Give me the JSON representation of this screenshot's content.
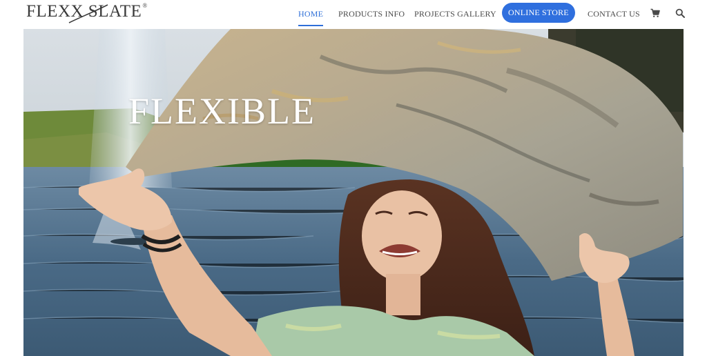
{
  "header": {
    "logo": {
      "text": "FLEXX SLATE",
      "registered": "®"
    },
    "nav": {
      "home": "HOME",
      "products": "PRODUCTS INFO",
      "gallery": "PROJECTS GALLERY",
      "store": "ONLINE STORE",
      "contact": "CONTACT US"
    },
    "icons": {
      "cart": "shopping-cart-icon",
      "search": "search-icon"
    },
    "active_tab": "HOME"
  },
  "hero": {
    "heading": "FLEXIBLE",
    "image": "woman-holding-flexible-stone-veneer-sheet-by-pond"
  },
  "colors": {
    "accent": "#2f6fde",
    "nav_text": "#4a4a4a",
    "logo": "#3a3a3a",
    "heading": "#ffffff"
  }
}
